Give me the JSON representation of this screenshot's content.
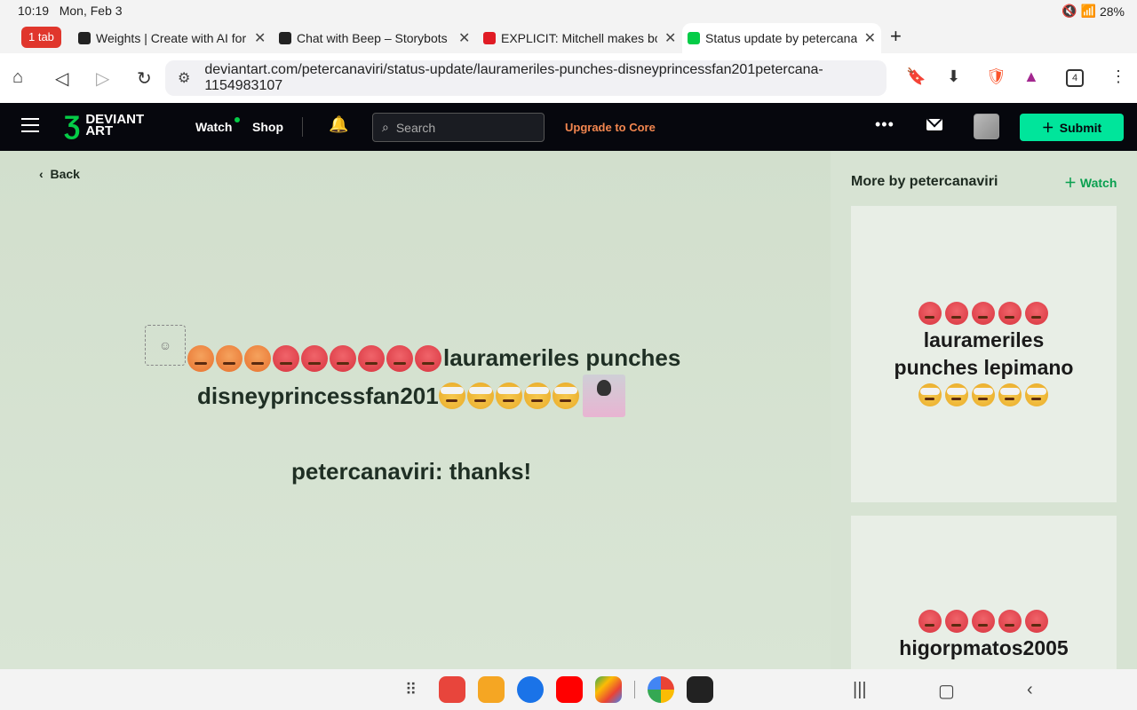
{
  "status_bar": {
    "time": "10:19",
    "date": "Mon, Feb 3",
    "battery": "28%"
  },
  "browser": {
    "tab_count": "1 tab",
    "tabs": [
      {
        "title": "Weights | Create with AI for F",
        "favicon_color": "#222222"
      },
      {
        "title": "Chat with Beep – Storybots |",
        "favicon_color": "#222222"
      },
      {
        "title": "EXPLICIT: Mitchell makes bo",
        "favicon_color": "#e01b24"
      },
      {
        "title": "Status update by petercanavi",
        "favicon_color": "#05cc47"
      }
    ],
    "url": "deviantart.com/petercanaviri/status-update/laurameriles-punches-disneyprincessfan201petercana-1154983107",
    "open_tabs_badge": "4"
  },
  "da_header": {
    "logo_line1": "DEVIANT",
    "logo_line2": "ART",
    "watch": "Watch",
    "shop": "Shop",
    "search_placeholder": "Search",
    "upgrade": "Upgrade to Core",
    "submit": "Submit"
  },
  "content": {
    "back": "Back",
    "status_text_line1": "laurameriles punches",
    "status_text_line2": "disneyprincessfan201",
    "reply": "petercanaviri: thanks!"
  },
  "sidebar": {
    "title": "More by petercanaviri",
    "watch": "Watch",
    "cards": [
      {
        "line1": "laurameriles",
        "line2": "punches lepimano"
      },
      {
        "line1": "higorpmatos2005",
        "line2": ""
      }
    ]
  },
  "colors": {
    "da_header_bg": "#06070d",
    "da_green": "#05cc47",
    "submit_bg": "#00e59b",
    "upgrade": "#f2864f",
    "content_bg": "#d2dfcd"
  }
}
